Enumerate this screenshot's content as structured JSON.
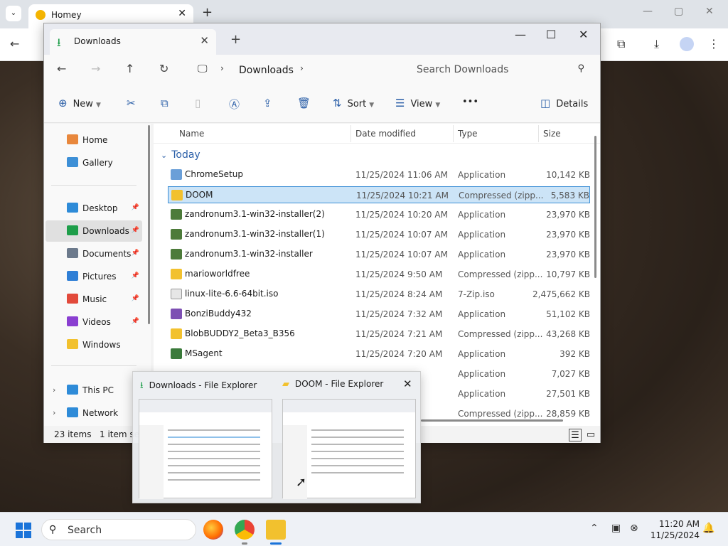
{
  "chrome": {
    "tab_title": "Homey",
    "tab_close": "✕",
    "new_tab": "+",
    "tabs_dropdown": "⌄",
    "minimize": "—",
    "maximize": "▢",
    "close": "✕"
  },
  "explorer": {
    "tab_title": "Downloads",
    "tab_close": "✕",
    "new_tab": "+",
    "minimize": "—",
    "maximize": "☐",
    "close": "✕",
    "breadcrumb": "Downloads",
    "breadcrumb_sep": "›",
    "search_placeholder": "Search Downloads",
    "commands": {
      "new": "New",
      "sort": "Sort",
      "view": "View",
      "more": "•••",
      "details": "Details"
    },
    "sidebar": {
      "quick": [
        {
          "label": "Home",
          "color": "#e8873c"
        },
        {
          "label": "Gallery",
          "color": "#3d8fd6"
        }
      ],
      "pinned": [
        {
          "label": "Desktop",
          "color": "#2e8bd8"
        },
        {
          "label": "Downloads",
          "color": "#1e9e4a"
        },
        {
          "label": "Documents",
          "color": "#6c7a8c"
        },
        {
          "label": "Pictures",
          "color": "#2f7fd6"
        },
        {
          "label": "Music",
          "color": "#e24a3b"
        },
        {
          "label": "Videos",
          "color": "#8a3fd1"
        },
        {
          "label": "Windows",
          "color": "#f2c12e"
        }
      ],
      "roots": [
        {
          "label": "This PC",
          "color": "#2e8bd8"
        },
        {
          "label": "Network",
          "color": "#2e8bd8"
        }
      ]
    },
    "columns": {
      "name": "Name",
      "date": "Date modified",
      "type": "Type",
      "size": "Size"
    },
    "group_label": "Today",
    "files": [
      {
        "name": "ChromeSetup",
        "date": "11/25/2024 11:06 AM",
        "type": "Application",
        "size": "10,142 KB",
        "icon_color": "#6a9fd8"
      },
      {
        "name": "DOOM",
        "date": "11/25/2024 10:21 AM",
        "type": "Compressed (zipp...",
        "size": "5,583 KB",
        "icon_color": "#f2c12e"
      },
      {
        "name": "zandronum3.1-win32-installer(2)",
        "date": "11/25/2024 10:20 AM",
        "type": "Application",
        "size": "23,970 KB",
        "icon_color": "#4d7b3a"
      },
      {
        "name": "zandronum3.1-win32-installer(1)",
        "date": "11/25/2024 10:07 AM",
        "type": "Application",
        "size": "23,970 KB",
        "icon_color": "#4d7b3a"
      },
      {
        "name": "zandronum3.1-win32-installer",
        "date": "11/25/2024 10:07 AM",
        "type": "Application",
        "size": "23,970 KB",
        "icon_color": "#4d7b3a"
      },
      {
        "name": "marioworldfree",
        "date": "11/25/2024 9:50 AM",
        "type": "Compressed (zipp...",
        "size": "10,797 KB",
        "icon_color": "#f2c12e"
      },
      {
        "name": "linux-lite-6.6-64bit.iso",
        "date": "11/25/2024 8:24 AM",
        "type": "7-Zip.iso",
        "size": "2,475,662 KB",
        "icon_color": "#e6e6e6"
      },
      {
        "name": "BonziBuddy432",
        "date": "11/25/2024 7:32 AM",
        "type": "Application",
        "size": "51,102 KB",
        "icon_color": "#7d4fb3"
      },
      {
        "name": "BlobBUDDY2_Beta3_B356",
        "date": "11/25/2024 7:21 AM",
        "type": "Compressed (zipp...",
        "size": "43,268 KB",
        "icon_color": "#f2c12e"
      },
      {
        "name": "MSagent",
        "date": "11/25/2024 7:20 AM",
        "type": "Application",
        "size": "392 KB",
        "icon_color": "#3a7a3a"
      }
    ],
    "hidden_rows": [
      {
        "type": "Application",
        "size": "7,027 KB"
      },
      {
        "type": "Application",
        "size": "27,501 KB"
      },
      {
        "type": "Compressed (zipp...",
        "size": "28,859 KB"
      }
    ],
    "status_count": "23 items",
    "status_selected": "1 item se"
  },
  "thumbnails": {
    "close": "✕",
    "items": [
      {
        "title": "Downloads - File Explorer"
      },
      {
        "title": "DOOM - File Explorer"
      }
    ]
  },
  "taskbar": {
    "search_placeholder": "Search",
    "time": "11:20 AM",
    "date": "11/25/2024"
  }
}
